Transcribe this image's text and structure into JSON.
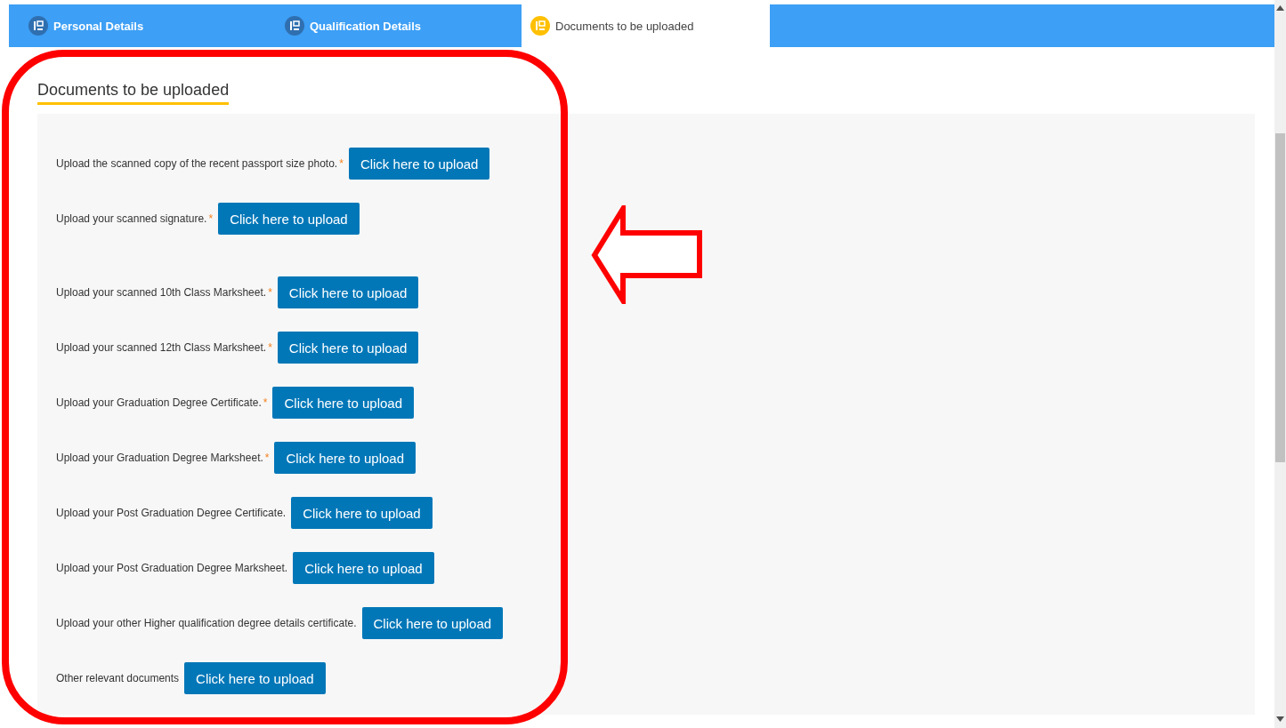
{
  "tabs": [
    {
      "label": "Personal Details",
      "selected": false
    },
    {
      "label": "Qualification Details",
      "selected": false
    },
    {
      "label": "Documents to be uploaded",
      "selected": true
    }
  ],
  "heading": "Documents to be uploaded",
  "documents": [
    {
      "label": "Upload the scanned copy of the recent passport size photo.",
      "required_mark": "*",
      "button": "Click here to upload"
    },
    {
      "label": "Upload your scanned signature.",
      "required_mark": "*",
      "button": "Click here to upload"
    },
    {
      "label": "Upload your scanned 10th Class Marksheet.",
      "required_mark": "*",
      "button": "Click here to upload"
    },
    {
      "label": "Upload your scanned 12th Class Marksheet.",
      "required_mark": "*",
      "button": "Click here to upload"
    },
    {
      "label": "Upload your Graduation Degree Certificate.",
      "required_mark": "*",
      "button": "Click here to upload"
    },
    {
      "label": "Upload your Graduation Degree Marksheet.",
      "required_mark": "*",
      "button": "Click here to upload"
    },
    {
      "label": "Upload your Post Graduation Degree Certificate.",
      "button": "Click here to upload"
    },
    {
      "label": "Upload your Post Graduation Degree Marksheet.",
      "button": "Click here to upload"
    },
    {
      "label": "Upload your other Higher qualification degree details certificate.",
      "button": "Click here to upload"
    },
    {
      "label": "Other relevant documents",
      "button": "Click here to upload"
    }
  ]
}
